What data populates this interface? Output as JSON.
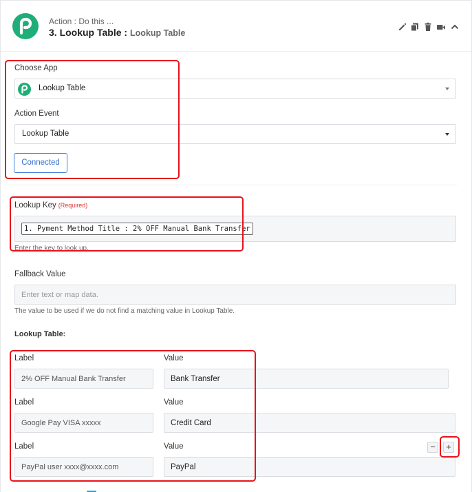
{
  "header": {
    "subtitle": "Action : Do this ...",
    "title": "3. Lookup Table : ",
    "app_name": "Lookup Table"
  },
  "colors": {
    "brand": "#1fae78",
    "accent": "#2f6fd0",
    "highlight": "#e8121b"
  },
  "choose_app": {
    "label": "Choose App",
    "value": "Lookup Table"
  },
  "action_event": {
    "label": "Action Event",
    "value": "Lookup Table"
  },
  "connected_label": "Connected",
  "lookup_key": {
    "label": "Lookup Key",
    "required": "(Required)",
    "chip": "1. Pyment Method Title : 2% OFF Manual Bank Transfer",
    "help": "Enter the key to look up."
  },
  "fallback": {
    "label": "Fallback Value",
    "placeholder": "Enter text or map data.",
    "help": "The value to be used if we do not find a matching value in Lookup Table."
  },
  "lookup_table": {
    "title": "Lookup Table:",
    "label_header": "Label",
    "value_header": "Value",
    "rows": [
      {
        "label": "2% OFF Manual Bank Transfer",
        "value": "Bank Transfer"
      },
      {
        "label": "Google Pay VISA xxxxx",
        "value": "Credit Card"
      },
      {
        "label": "PayPal user xxxx@xxxx.com",
        "value": "PayPal"
      }
    ],
    "minus": "−",
    "plus": "+"
  },
  "icons": [
    "edit-icon",
    "copy-icon",
    "trash-icon",
    "video-icon",
    "chevron-up-icon"
  ]
}
